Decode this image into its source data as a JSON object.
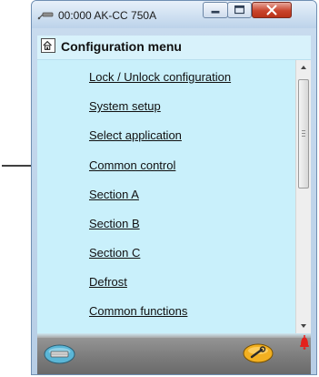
{
  "window": {
    "title": "00:000 AK-CC 750A"
  },
  "header": {
    "title": "Configuration menu"
  },
  "menu": {
    "items": [
      "Lock / Unlock configuration",
      "System setup",
      "Select application",
      "Common control",
      "Section A",
      "Section B",
      "Section C",
      "Defrost",
      "Common functions"
    ]
  },
  "icons": {
    "app": "probe-icon",
    "home": "home-icon",
    "minimize": "minimize-icon",
    "maximize": "maximize-icon",
    "close": "close-icon",
    "annotation": "arrow-right-icon",
    "footer_left": "keyboard-icon",
    "footer_right": "wrench-icon",
    "alarm": "bell-icon"
  },
  "colors": {
    "content_bg": "#c9f0fb",
    "close_button": "#c9442d",
    "footer_right_button": "#f2b021",
    "footer_left_button": "#5bb6d6",
    "alarm_bell": "#e3211c"
  }
}
